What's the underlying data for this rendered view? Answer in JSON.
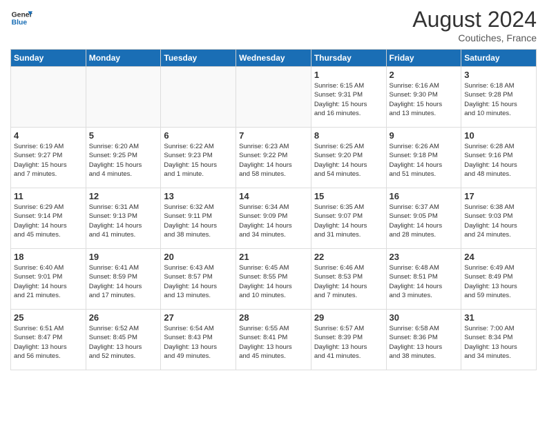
{
  "header": {
    "logo_line1": "General",
    "logo_line2": "Blue",
    "month_year": "August 2024",
    "location": "Coutiches, France"
  },
  "days_of_week": [
    "Sunday",
    "Monday",
    "Tuesday",
    "Wednesday",
    "Thursday",
    "Friday",
    "Saturday"
  ],
  "weeks": [
    [
      {
        "day": "",
        "info": ""
      },
      {
        "day": "",
        "info": ""
      },
      {
        "day": "",
        "info": ""
      },
      {
        "day": "",
        "info": ""
      },
      {
        "day": "1",
        "info": "Sunrise: 6:15 AM\nSunset: 9:31 PM\nDaylight: 15 hours\nand 16 minutes."
      },
      {
        "day": "2",
        "info": "Sunrise: 6:16 AM\nSunset: 9:30 PM\nDaylight: 15 hours\nand 13 minutes."
      },
      {
        "day": "3",
        "info": "Sunrise: 6:18 AM\nSunset: 9:28 PM\nDaylight: 15 hours\nand 10 minutes."
      }
    ],
    [
      {
        "day": "4",
        "info": "Sunrise: 6:19 AM\nSunset: 9:27 PM\nDaylight: 15 hours\nand 7 minutes."
      },
      {
        "day": "5",
        "info": "Sunrise: 6:20 AM\nSunset: 9:25 PM\nDaylight: 15 hours\nand 4 minutes."
      },
      {
        "day": "6",
        "info": "Sunrise: 6:22 AM\nSunset: 9:23 PM\nDaylight: 15 hours\nand 1 minute."
      },
      {
        "day": "7",
        "info": "Sunrise: 6:23 AM\nSunset: 9:22 PM\nDaylight: 14 hours\nand 58 minutes."
      },
      {
        "day": "8",
        "info": "Sunrise: 6:25 AM\nSunset: 9:20 PM\nDaylight: 14 hours\nand 54 minutes."
      },
      {
        "day": "9",
        "info": "Sunrise: 6:26 AM\nSunset: 9:18 PM\nDaylight: 14 hours\nand 51 minutes."
      },
      {
        "day": "10",
        "info": "Sunrise: 6:28 AM\nSunset: 9:16 PM\nDaylight: 14 hours\nand 48 minutes."
      }
    ],
    [
      {
        "day": "11",
        "info": "Sunrise: 6:29 AM\nSunset: 9:14 PM\nDaylight: 14 hours\nand 45 minutes."
      },
      {
        "day": "12",
        "info": "Sunrise: 6:31 AM\nSunset: 9:13 PM\nDaylight: 14 hours\nand 41 minutes."
      },
      {
        "day": "13",
        "info": "Sunrise: 6:32 AM\nSunset: 9:11 PM\nDaylight: 14 hours\nand 38 minutes."
      },
      {
        "day": "14",
        "info": "Sunrise: 6:34 AM\nSunset: 9:09 PM\nDaylight: 14 hours\nand 34 minutes."
      },
      {
        "day": "15",
        "info": "Sunrise: 6:35 AM\nSunset: 9:07 PM\nDaylight: 14 hours\nand 31 minutes."
      },
      {
        "day": "16",
        "info": "Sunrise: 6:37 AM\nSunset: 9:05 PM\nDaylight: 14 hours\nand 28 minutes."
      },
      {
        "day": "17",
        "info": "Sunrise: 6:38 AM\nSunset: 9:03 PM\nDaylight: 14 hours\nand 24 minutes."
      }
    ],
    [
      {
        "day": "18",
        "info": "Sunrise: 6:40 AM\nSunset: 9:01 PM\nDaylight: 14 hours\nand 21 minutes."
      },
      {
        "day": "19",
        "info": "Sunrise: 6:41 AM\nSunset: 8:59 PM\nDaylight: 14 hours\nand 17 minutes."
      },
      {
        "day": "20",
        "info": "Sunrise: 6:43 AM\nSunset: 8:57 PM\nDaylight: 14 hours\nand 13 minutes."
      },
      {
        "day": "21",
        "info": "Sunrise: 6:45 AM\nSunset: 8:55 PM\nDaylight: 14 hours\nand 10 minutes."
      },
      {
        "day": "22",
        "info": "Sunrise: 6:46 AM\nSunset: 8:53 PM\nDaylight: 14 hours\nand 7 minutes."
      },
      {
        "day": "23",
        "info": "Sunrise: 6:48 AM\nSunset: 8:51 PM\nDaylight: 14 hours\nand 3 minutes."
      },
      {
        "day": "24",
        "info": "Sunrise: 6:49 AM\nSunset: 8:49 PM\nDaylight: 13 hours\nand 59 minutes."
      }
    ],
    [
      {
        "day": "25",
        "info": "Sunrise: 6:51 AM\nSunset: 8:47 PM\nDaylight: 13 hours\nand 56 minutes."
      },
      {
        "day": "26",
        "info": "Sunrise: 6:52 AM\nSunset: 8:45 PM\nDaylight: 13 hours\nand 52 minutes."
      },
      {
        "day": "27",
        "info": "Sunrise: 6:54 AM\nSunset: 8:43 PM\nDaylight: 13 hours\nand 49 minutes."
      },
      {
        "day": "28",
        "info": "Sunrise: 6:55 AM\nSunset: 8:41 PM\nDaylight: 13 hours\nand 45 minutes."
      },
      {
        "day": "29",
        "info": "Sunrise: 6:57 AM\nSunset: 8:39 PM\nDaylight: 13 hours\nand 41 minutes."
      },
      {
        "day": "30",
        "info": "Sunrise: 6:58 AM\nSunset: 8:36 PM\nDaylight: 13 hours\nand 38 minutes."
      },
      {
        "day": "31",
        "info": "Sunrise: 7:00 AM\nSunset: 8:34 PM\nDaylight: 13 hours\nand 34 minutes."
      }
    ]
  ]
}
